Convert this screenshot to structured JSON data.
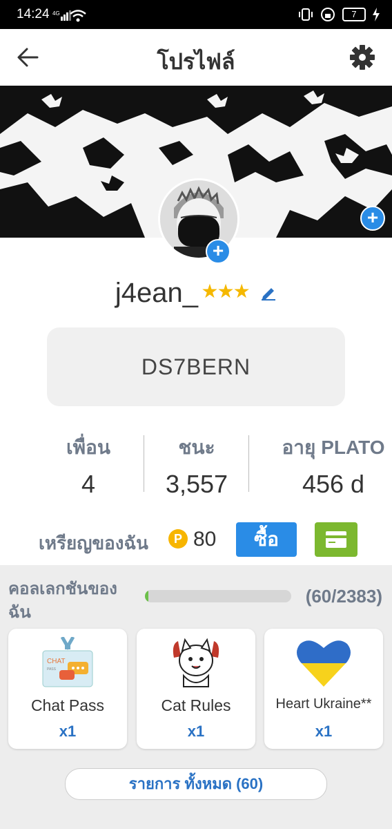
{
  "status_bar": {
    "time": "14:24",
    "battery": "7"
  },
  "header": {
    "title": "โปรไฟล์"
  },
  "profile": {
    "username": "j4ean_",
    "stars": "★★★",
    "code": "DS7BERN"
  },
  "stats": [
    {
      "label": "เพื่อน",
      "value": "4"
    },
    {
      "label": "ชนะ",
      "value": "3,557"
    },
    {
      "label": "อายุ PLATO",
      "value": "456 d"
    }
  ],
  "coins": {
    "label": "เหรียญของฉัน",
    "coin_letter": "P",
    "amount": "80",
    "buy_label": "ซื้อ"
  },
  "collection": {
    "title": "คอลเลกชันของฉัน",
    "progress_text": "(60/2383)",
    "progress_fraction": 0.025,
    "items": [
      {
        "name": "Chat Pass",
        "qty": "x1",
        "icon": "chat-pass-icon"
      },
      {
        "name": "Cat Rules",
        "qty": "x1",
        "icon": "cat-icon"
      },
      {
        "name": "Heart Ukraine**",
        "qty": "x1",
        "icon": "heart-ukraine-icon"
      }
    ],
    "all_label": "รายการ ทั้งหมด (60)"
  },
  "colors": {
    "accent_blue": "#2a8ce6",
    "wallet_green": "#7cb82f",
    "coin_gold": "#f7b500",
    "star": "#f5b800"
  }
}
